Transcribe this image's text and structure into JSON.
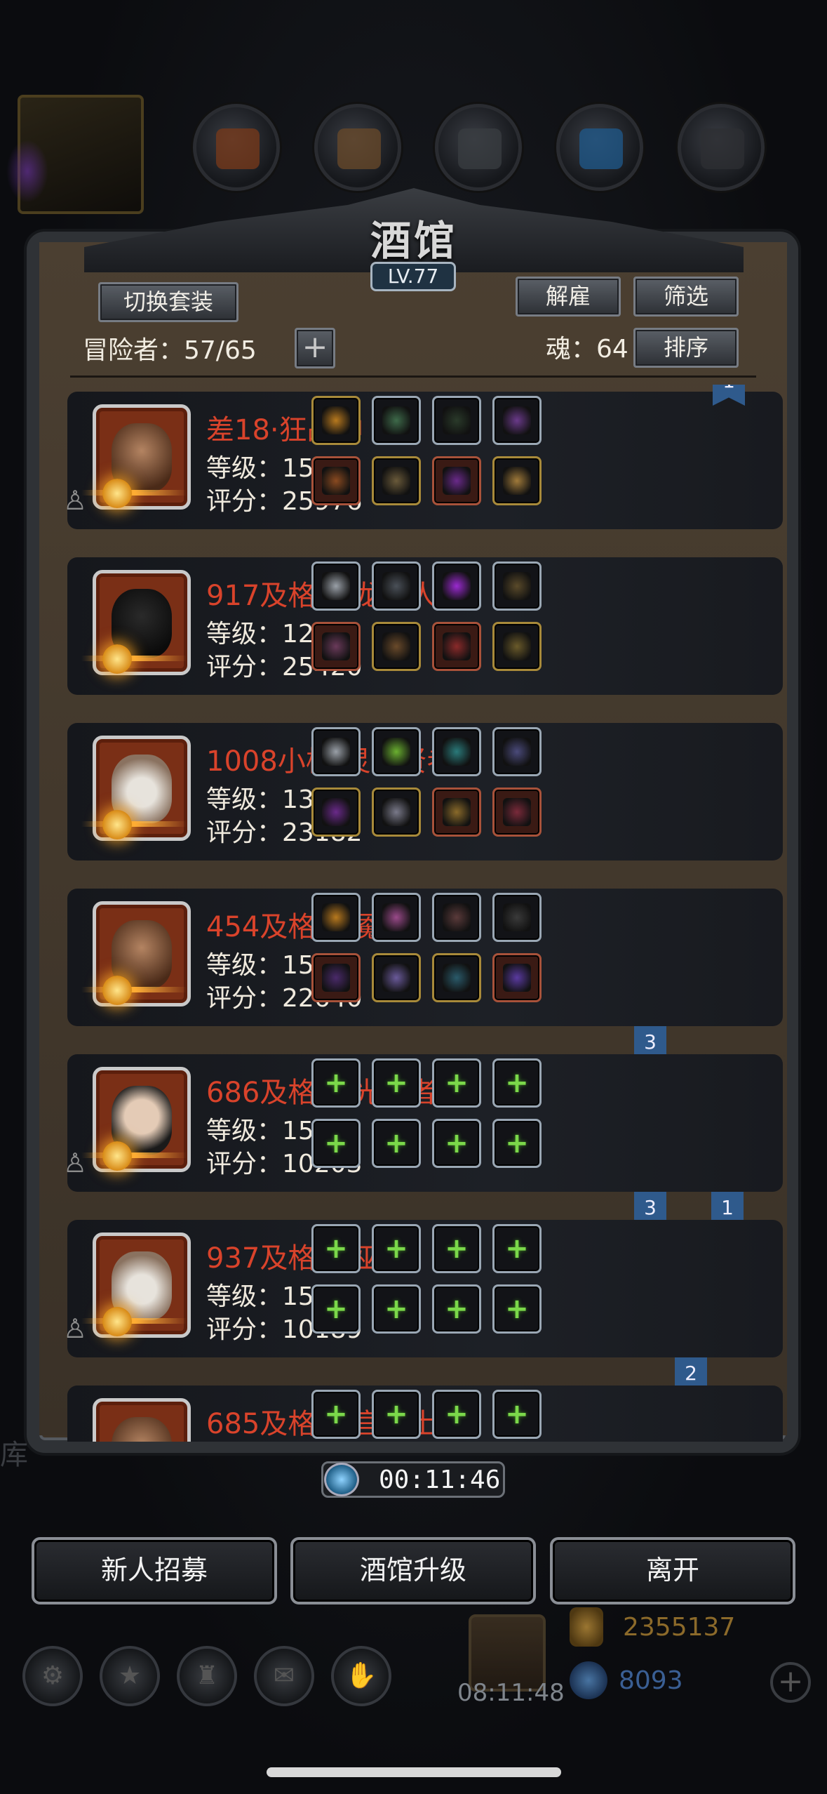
{
  "window": {
    "title": "酒馆",
    "level": "LV.77"
  },
  "header": {
    "switch_suit": "切换套装",
    "adventurers_label": "冒险者：57/65",
    "add": "+",
    "dismiss": "解雇",
    "filter": "筛选",
    "souls_label": "魂：64",
    "sort": "排序"
  },
  "heroes": [
    {
      "name": "差18·狂战神",
      "level": "等级：150",
      "score": "评分：25976",
      "face": "brute",
      "flag": "1"
    },
    {
      "name": "917及格·巨龙猎人",
      "level": "等级：129",
      "score": "评分：25420",
      "face": "dark",
      "flag": ""
    },
    {
      "name": "1008小极·灵魂贤者",
      "level": "等级：137",
      "score": "评分：23182",
      "face": "old",
      "flag": ""
    },
    {
      "name": "454及格·夜魇",
      "level": "等级：150",
      "score": "评分：22640",
      "face": "brute",
      "flag": "3"
    },
    {
      "name": "686及格·圣光贤者",
      "level": "等级：150",
      "score": "评分：10203",
      "face": "nun",
      "flag": "3"
    },
    {
      "name": "937及格·大巫医",
      "level": "等级：150",
      "score": "评分：10189",
      "face": "old",
      "flag": "2"
    },
    {
      "name": "685及格·神官骑士",
      "level": "",
      "score": "",
      "face": "brute",
      "flag": ""
    }
  ],
  "colors": {
    "hero_name": "#d9432b",
    "plus_green": "#7bd84a",
    "flag_blue": "#2f5a8c"
  },
  "timer": {
    "value": "00:11:46",
    "icon": "clock-icon"
  },
  "bottom_buttons": {
    "recruit": "新人招募",
    "upgrade": "酒馆升级",
    "leave": "离开"
  },
  "status": {
    "gift_timer": "08:11:48",
    "gold": "2355137",
    "gems": "8093",
    "gem_plus": "+"
  },
  "background_text": {
    "ku": "库"
  }
}
